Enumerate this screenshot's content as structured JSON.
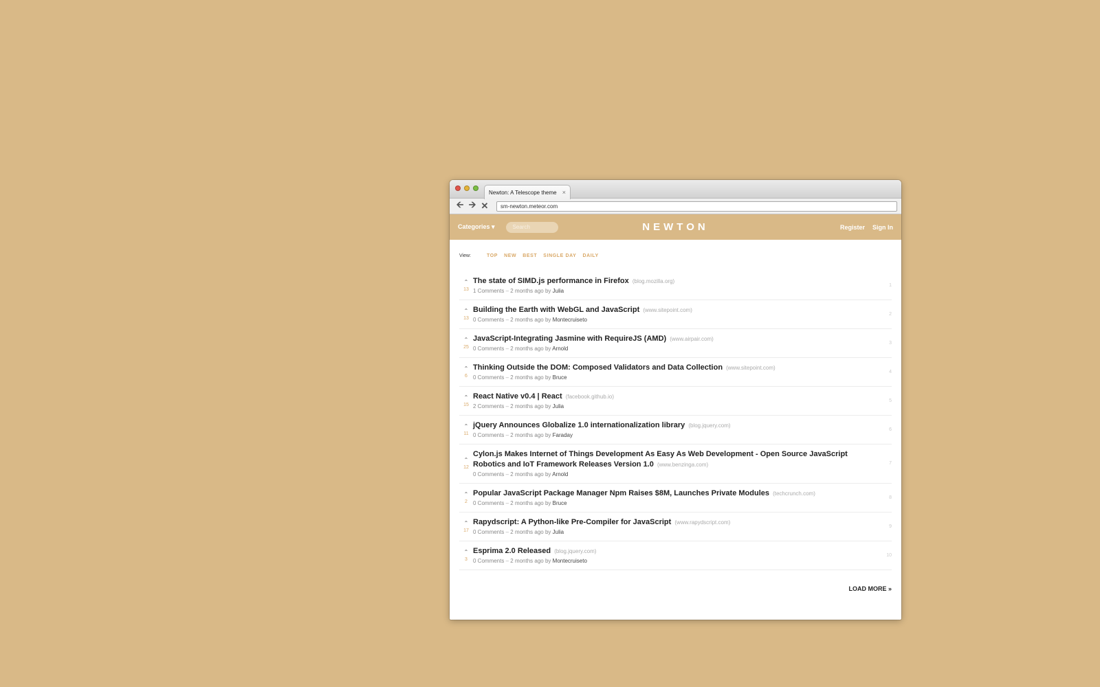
{
  "browser": {
    "tab_title": "Newton: A Telescope theme",
    "tab_close": "×",
    "url": "sm-newton.meteor.com"
  },
  "header": {
    "categories": "Categories ▾",
    "search_placeholder": "Search",
    "logo": "NEWTON",
    "register": "Register",
    "sign_in": "Sign In"
  },
  "views": {
    "label": "View:",
    "items": [
      "TOP",
      "NEW",
      "BEST",
      "SINGLE DAY",
      "DAILY"
    ]
  },
  "posts": [
    {
      "title": "The state of SIMD.js performance in Firefox",
      "domain": "(blog.mozilla.org)",
      "score": "13",
      "comments": "1 Comments",
      "time": "2 months ago",
      "author": "Julia",
      "rank": "1"
    },
    {
      "title": "Building the Earth with WebGL and JavaScript",
      "domain": "(www.sitepoint.com)",
      "score": "13",
      "comments": "0 Comments",
      "time": "2 months ago",
      "author": "Montecruiseto",
      "rank": "2"
    },
    {
      "title": "JavaScript-Integrating Jasmine with RequireJS (AMD)",
      "domain": "(www.airpair.com)",
      "score": "25",
      "comments": "0 Comments",
      "time": "2 months ago",
      "author": "Arnold",
      "rank": "3"
    },
    {
      "title": "Thinking Outside the DOM: Composed Validators and Data Collection",
      "domain": "(www.sitepoint.com)",
      "score": "6",
      "comments": "0 Comments",
      "time": "2 months ago",
      "author": "Bruce",
      "rank": "4"
    },
    {
      "title": "React Native v0.4 | React",
      "domain": "(facebook.github.io)",
      "score": "15",
      "comments": "2 Comments",
      "time": "2 months ago",
      "author": "Julia",
      "rank": "5"
    },
    {
      "title": "jQuery Announces Globalize 1.0 internationalization library",
      "domain": "(blog.jquery.com)",
      "score": "11",
      "comments": "0 Comments",
      "time": "2 months ago",
      "author": "Faraday",
      "rank": "6"
    },
    {
      "title": "Cylon.js Makes Internet of Things Development As Easy As Web Development - Open Source JavaScript Robotics and IoT Framework Releases Version 1.0",
      "domain": "(www.benzinga.com)",
      "score": "12",
      "comments": "0 Comments",
      "time": "2 months ago",
      "author": "Arnold",
      "rank": "7"
    },
    {
      "title": "Popular JavaScript Package Manager Npm Raises $8M, Launches Private Modules",
      "domain": "(techcrunch.com)",
      "score": "2",
      "comments": "0 Comments",
      "time": "2 months ago",
      "author": "Bruce",
      "rank": "8"
    },
    {
      "title": "Rapydscript: A Python-like Pre-Compiler for JavaScript",
      "domain": "(www.rapydscript.com)",
      "score": "17",
      "comments": "0 Comments",
      "time": "2 months ago",
      "author": "Julia",
      "rank": "9"
    },
    {
      "title": "Esprima 2.0 Released",
      "domain": "(blog.jquery.com)",
      "score": "3",
      "comments": "0 Comments",
      "time": "2 months ago",
      "author": "Montecruiseto",
      "rank": "10"
    }
  ],
  "load_more": "LOAD MORE »"
}
